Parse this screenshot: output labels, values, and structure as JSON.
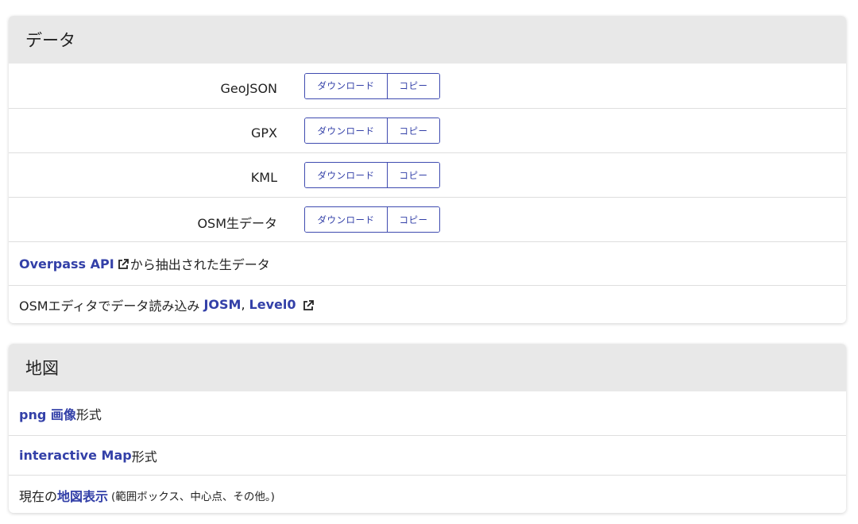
{
  "data_section": {
    "title": "データ",
    "formats": [
      {
        "label": "GeoJSON",
        "download": "ダウンロード",
        "copy": "コピー"
      },
      {
        "label": "GPX",
        "download": "ダウンロード",
        "copy": "コピー"
      },
      {
        "label": "KML",
        "download": "ダウンロード",
        "copy": "コピー"
      },
      {
        "label": "OSM生データ",
        "download": "ダウンロード",
        "copy": "コピー"
      }
    ],
    "overpass_link": "Overpass API",
    "overpass_suffix": "から抽出された生データ",
    "editor_prefix": "OSMエディタでデータ読み込み",
    "josm_link": "JOSM",
    "separator": ",",
    "level0_link": "Level0"
  },
  "map_section": {
    "title": "地図",
    "png_link": "png 画像",
    "png_suffix": "形式",
    "interactive_link": "interactive Map",
    "interactive_suffix": "形式",
    "current_prefix": "現在の",
    "current_link": "地図表示",
    "current_note": "(範囲ボックス、中心点、その他。)"
  },
  "icons": {
    "external_link": "external-link-icon"
  },
  "colors": {
    "link": "#3340a8",
    "header_bg": "#e8e8e8"
  }
}
